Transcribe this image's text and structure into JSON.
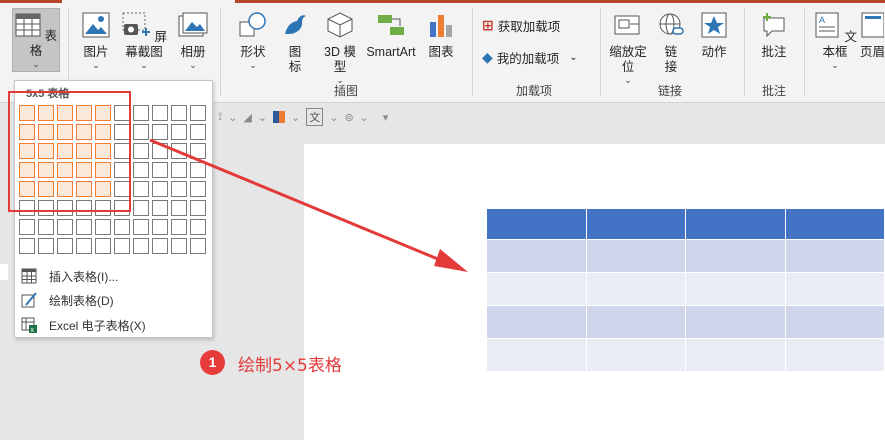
{
  "ribbon": {
    "table_label": "表格",
    "picture_label": "图片",
    "screenshot_label": "屏幕截图",
    "album_label": "相册",
    "shapes_label": "形状",
    "icons_label": "图标",
    "model3d_label": "3D 模型",
    "smartart_label": "SmartArt",
    "chart_label": "图表",
    "get_addins_label": "获取加载项",
    "my_addins_label": "我的加载项",
    "zoom_label": "缩放定位",
    "link_label": "链接",
    "action_label": "动作",
    "comment_label": "批注",
    "textbox_label": "文本框",
    "header_label": "页眉和",
    "group_illustrations": "插图",
    "group_addins": "加载项",
    "group_links": "链接",
    "group_comments": "批注",
    "accent_color": "#b7472a"
  },
  "dropdown": {
    "grid_title": "5x5 表格",
    "grid_rows": 8,
    "grid_cols": 10,
    "selected_rows": 5,
    "selected_cols": 5,
    "insert_table": "插入表格(I)...",
    "draw_table": "绘制表格(D)",
    "excel_table": "Excel 电子表格(X)"
  },
  "annotation": {
    "step_number": "1",
    "step_text": "绘制5×5表格",
    "color": "#e33a3a"
  },
  "slide_table": {
    "header_color": "#4472c4",
    "band1_color": "#cfd5ea",
    "band2_color": "#e9ebf5"
  }
}
